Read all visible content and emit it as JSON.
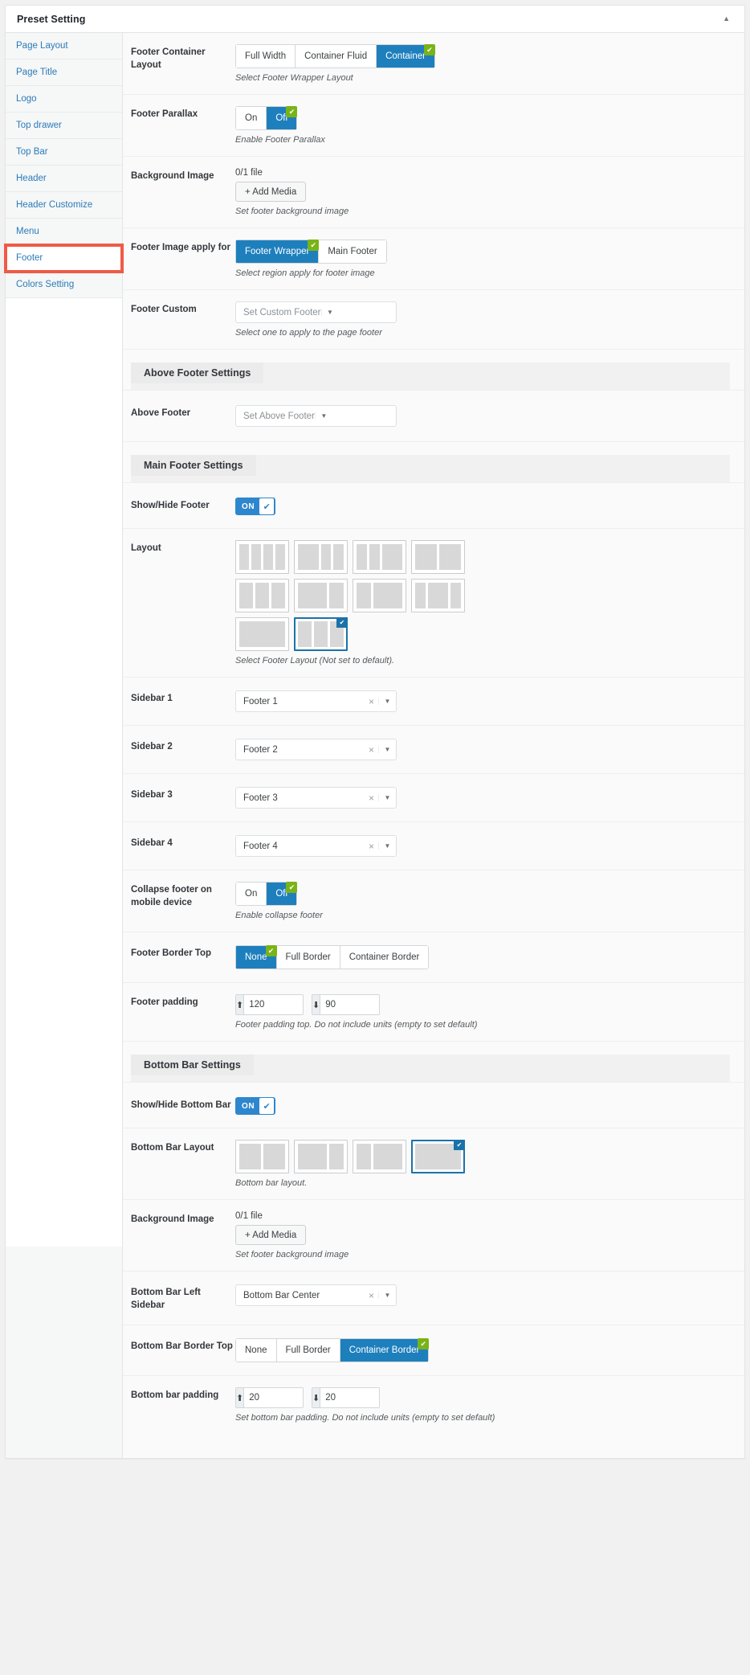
{
  "header": {
    "title": "Preset Setting",
    "collapse_icon": "chevron-up-icon"
  },
  "sidebar": {
    "items": [
      {
        "label": "Page Layout",
        "active": false
      },
      {
        "label": "Page Title",
        "active": false
      },
      {
        "label": "Logo",
        "active": false
      },
      {
        "label": "Top drawer",
        "active": false
      },
      {
        "label": "Top Bar",
        "active": false
      },
      {
        "label": "Header",
        "active": false
      },
      {
        "label": "Header Customize",
        "active": false
      },
      {
        "label": "Menu",
        "active": false
      },
      {
        "label": "Footer",
        "active": true
      },
      {
        "label": "Colors Setting",
        "active": false
      }
    ],
    "highlight_color": "#ef5a46",
    "link_color": "#2b7bb9"
  },
  "rows": {
    "footer_container_layout": {
      "label": "Footer Container Layout",
      "options": [
        "Full Width",
        "Container Fluid",
        "Container"
      ],
      "selected": "Container",
      "desc": "Select Footer Wrapper Layout"
    },
    "footer_parallax": {
      "label": "Footer Parallax",
      "options": [
        "On",
        "Off"
      ],
      "selected": "Off",
      "desc": "Enable Footer Parallax"
    },
    "background_image": {
      "label": "Background Image",
      "file_count": "0/1 file",
      "button": "+ Add Media",
      "desc": "Set footer background image"
    },
    "footer_image_apply_for": {
      "label": "Footer Image apply for",
      "options": [
        "Footer Wrapper",
        "Main Footer"
      ],
      "selected": "Footer Wrapper",
      "desc": "Select region apply for footer image"
    },
    "footer_custom": {
      "label": "Footer Custom",
      "placeholder": "Set Custom Footer",
      "value": "",
      "desc": "Select one to apply to the page footer"
    },
    "above_footer_section": {
      "title": "Above Footer Settings"
    },
    "above_footer": {
      "label": "Above Footer",
      "placeholder": "Set Above Footer",
      "value": ""
    },
    "main_footer_section": {
      "title": "Main Footer Settings"
    },
    "show_hide_footer": {
      "label": "Show/Hide Footer",
      "state": "ON",
      "check_icon": "check-icon"
    },
    "layout": {
      "label": "Layout",
      "desc": "Select Footer Layout (Not set to default).",
      "thumbs": [
        {
          "cols": [
            1,
            1,
            1,
            1
          ],
          "selected": false
        },
        {
          "cols": [
            2,
            1,
            1
          ],
          "selected": false
        },
        {
          "cols": [
            1,
            1,
            2
          ],
          "selected": false
        },
        {
          "cols": [
            1,
            1
          ],
          "selected": false
        },
        {
          "cols": [
            1,
            1,
            1
          ],
          "selected": false
        },
        {
          "cols": [
            2,
            1
          ],
          "selected": false
        },
        {
          "cols": [
            1,
            2
          ],
          "selected": false
        },
        {
          "cols": [
            1,
            2,
            1
          ],
          "selected": false
        },
        {
          "cols": [
            1
          ],
          "selected": false
        },
        {
          "cols": [
            1,
            1,
            1
          ],
          "selected": true
        }
      ]
    },
    "sidebar_1": {
      "label": "Sidebar 1",
      "value": "Footer 1"
    },
    "sidebar_2": {
      "label": "Sidebar 2",
      "value": "Footer 2"
    },
    "sidebar_3": {
      "label": "Sidebar 3",
      "value": "Footer 3"
    },
    "sidebar_4": {
      "label": "Sidebar 4",
      "value": "Footer 4"
    },
    "collapse_footer": {
      "label": "Collapse footer on mobile device",
      "options": [
        "On",
        "Off"
      ],
      "selected": "Off",
      "desc": "Enable collapse footer"
    },
    "footer_border_top": {
      "label": "Footer Border Top",
      "options": [
        "None",
        "Full Border",
        "Container Border"
      ],
      "selected": "None",
      "desc": ""
    },
    "footer_padding": {
      "label": "Footer padding",
      "top_icon": "arrow-up-icon",
      "top_value": "120",
      "bottom_icon": "arrow-down-icon",
      "bottom_value": "90",
      "desc": "Footer padding top. Do not include units (empty to set default)"
    },
    "bottom_bar_section": {
      "title": "Bottom Bar Settings"
    },
    "show_hide_bottom_bar": {
      "label": "Show/Hide Bottom Bar",
      "state": "ON",
      "check_icon": "check-icon"
    },
    "bottom_bar_layout": {
      "label": "Bottom Bar Layout",
      "desc": "Bottom bar layout.",
      "thumbs": [
        {
          "cols": [
            1,
            1
          ],
          "selected": false
        },
        {
          "cols": [
            2,
            1
          ],
          "selected": false
        },
        {
          "cols": [
            1,
            2
          ],
          "selected": false
        },
        {
          "cols": [
            1
          ],
          "selected": true
        }
      ]
    },
    "bb_background_image": {
      "label": "Background Image",
      "file_count": "0/1 file",
      "button": "+ Add Media",
      "desc": "Set footer background image"
    },
    "bottom_bar_left_sidebar": {
      "label": "Bottom Bar Left Sidebar",
      "value": "Bottom Bar Center"
    },
    "bottom_bar_border_top": {
      "label": "Bottom Bar Border Top",
      "options": [
        "None",
        "Full Border",
        "Container Border"
      ],
      "selected": "Container Border"
    },
    "bottom_bar_padding": {
      "label": "Bottom bar padding",
      "top_icon": "arrow-up-icon",
      "top_value": "20",
      "bottom_icon": "arrow-down-icon",
      "bottom_value": "20",
      "desc": "Set bottom bar padding. Do not include units (empty to set default)"
    }
  },
  "colors": {
    "accent_blue": "#1e7fbd",
    "toggle_blue": "#2e87ce",
    "tick_green": "#7ab317",
    "selected_border": "#1a73a8",
    "highlight_red": "#ef5a46"
  }
}
